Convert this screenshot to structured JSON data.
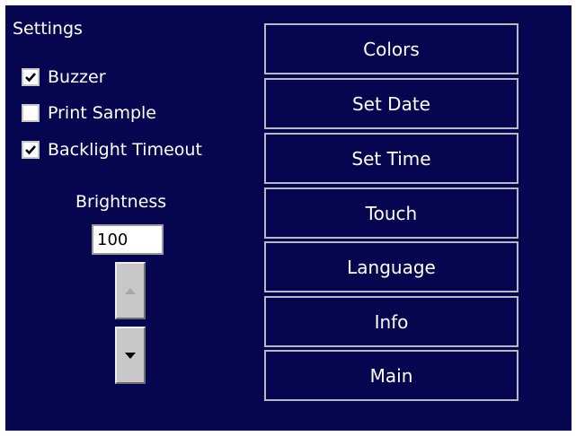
{
  "settings": {
    "title": "Settings",
    "options": [
      {
        "label": "Buzzer",
        "checked": true
      },
      {
        "label": "Print Sample",
        "checked": false
      },
      {
        "label": "Backlight Timeout",
        "checked": true
      }
    ],
    "brightness_label": "Brightness",
    "brightness_value": "100",
    "spin_up_icon": "triangle-up-icon",
    "spin_down_icon": "triangle-down-icon"
  },
  "menu": {
    "buttons": [
      "Colors",
      "Set Date",
      "Set Time",
      "Touch",
      "Language",
      "Info",
      "Main"
    ]
  },
  "colors": {
    "background": "#060650",
    "button_border": "#b8b8c0",
    "text": "#ffffff",
    "spin_button": "#c8c8c8"
  }
}
